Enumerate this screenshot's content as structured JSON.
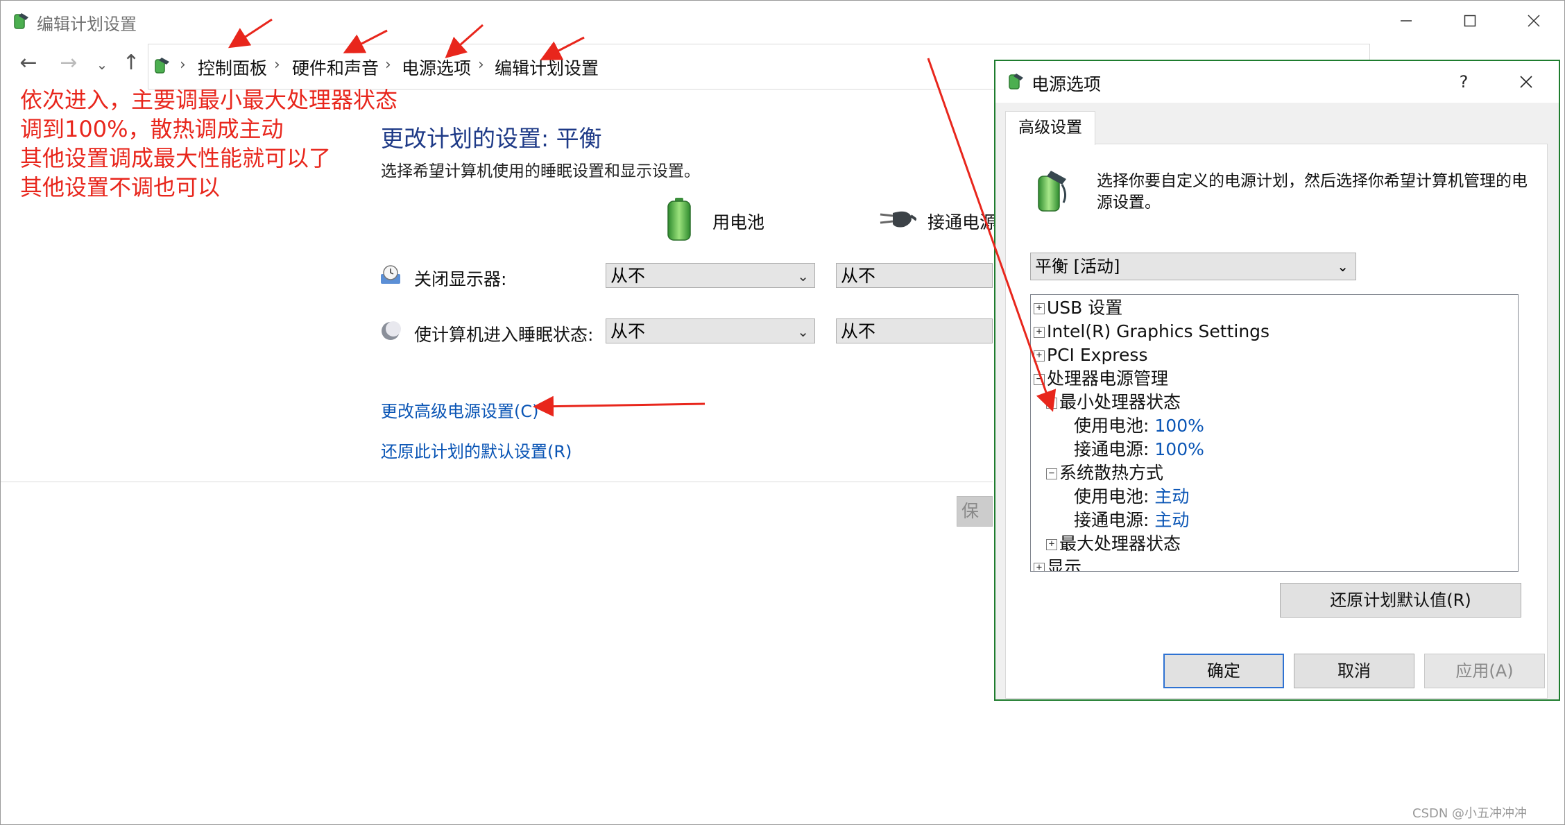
{
  "window": {
    "title": "编辑计划设置",
    "minimize_icon": "minimize-icon",
    "maximize_icon": "maximize-icon",
    "close_icon": "close-icon"
  },
  "nav": {
    "back_icon": "back-arrow-icon",
    "forward_icon": "forward-arrow-icon",
    "recent_icon": "chevron-down-icon",
    "up_icon": "up-arrow-icon"
  },
  "breadcrumb": [
    "控制面板",
    "硬件和声音",
    "电源选项",
    "编辑计划设置"
  ],
  "annotation_lines": [
    "依次进入，主要调最小最大处理器状态",
    "调到100%，散热调成主动",
    "其他设置调成最大性能就可以了",
    "其他设置不调也可以"
  ],
  "page": {
    "heading": "更改计划的设置: 平衡",
    "subtitle": "选择希望计算机使用的睡眠设置和显示设置。",
    "col_battery": "用电池",
    "col_plugged": "接通电源",
    "rows": [
      {
        "label": "关闭显示器:",
        "battery_value": "从不",
        "plugged_value": "从不"
      },
      {
        "label": "使计算机进入睡眠状态:",
        "battery_value": "从不",
        "plugged_value": "从不"
      }
    ],
    "advanced_link": "更改高级电源设置(C)",
    "restore_link": "还原此计划的默认设置(R)",
    "save_partial": "保"
  },
  "dialog": {
    "title": "电源选项",
    "help": "?",
    "tab": "高级设置",
    "description": "选择你要自定义的电源计划，然后选择你希望计算机管理的电源设置。",
    "plan": "平衡 [活动]",
    "tree": [
      {
        "label": "USB 设置",
        "expander": "+",
        "value": ""
      },
      {
        "label": "Intel(R) Graphics Settings",
        "expander": "+",
        "value": ""
      },
      {
        "label": "PCI Express",
        "expander": "+",
        "value": ""
      },
      {
        "label": "处理器电源管理",
        "expander": "−",
        "value": ""
      },
      {
        "label": "最小处理器状态",
        "expander": "−",
        "value": ""
      },
      {
        "label": "使用电池:",
        "expander": "",
        "value": "100%"
      },
      {
        "label": "接通电源:",
        "expander": "",
        "value": "100%"
      },
      {
        "label": "系统散热方式",
        "expander": "−",
        "value": ""
      },
      {
        "label": "使用电池:",
        "expander": "",
        "value": "主动"
      },
      {
        "label": "接通电源:",
        "expander": "",
        "value": "主动"
      },
      {
        "label": "最大处理器状态",
        "expander": "+",
        "value": ""
      },
      {
        "label": "显示",
        "expander": "+",
        "value": ""
      }
    ],
    "restore_defaults": "还原计划默认值(R)",
    "ok": "确定",
    "cancel": "取消",
    "apply": "应用(A)"
  },
  "watermark": "CSDN @小五冲冲冲",
  "colors": {
    "annotation": "#e8261c",
    "link": "#0a55b5",
    "heading": "#1e3a87",
    "dialog_border": "#1e7c2e"
  }
}
